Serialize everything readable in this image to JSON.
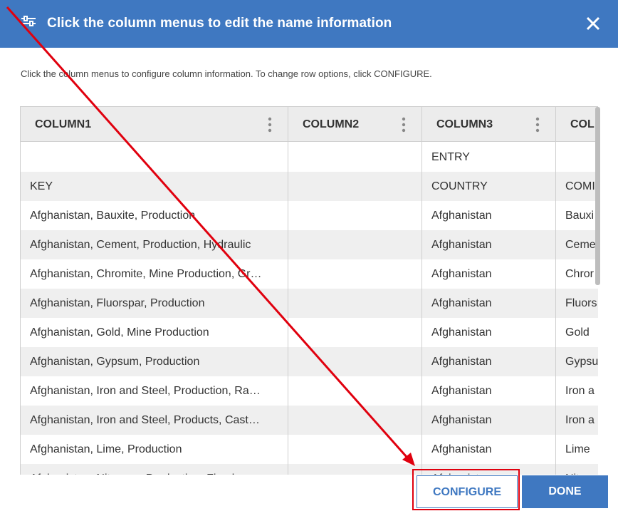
{
  "dialog": {
    "title": "Click the column menus to edit the name information",
    "instructions": "Click the column menus to configure column information. To change row options, click CONFIGURE."
  },
  "columns": [
    {
      "label": "COLUMN1"
    },
    {
      "label": "COLUMN2"
    },
    {
      "label": "COLUMN3"
    },
    {
      "label": "COL"
    }
  ],
  "rows": [
    {
      "c1": "",
      "c3": "ENTRY",
      "c4": ""
    },
    {
      "c1": "KEY",
      "c3": "COUNTRY",
      "c4": "COMI"
    },
    {
      "c1": "Afghanistan, Bauxite, Production",
      "c3": "Afghanistan",
      "c4": "Bauxi"
    },
    {
      "c1": "Afghanistan, Cement, Production, Hydraulic",
      "c3": "Afghanistan",
      "c4": "Ceme"
    },
    {
      "c1": "Afghanistan, Chromite, Mine Production, Gr…",
      "c3": "Afghanistan",
      "c4": "Chror"
    },
    {
      "c1": "Afghanistan, Fluorspar, Production",
      "c3": "Afghanistan",
      "c4": "Fluors"
    },
    {
      "c1": "Afghanistan, Gold, Mine Production",
      "c3": "Afghanistan",
      "c4": "Gold"
    },
    {
      "c1": "Afghanistan, Gypsum, Production",
      "c3": "Afghanistan",
      "c4": "Gypsu"
    },
    {
      "c1": "Afghanistan, Iron and Steel, Production, Ra…",
      "c3": "Afghanistan",
      "c4": "Iron a"
    },
    {
      "c1": "Afghanistan, Iron and Steel, Products, Cast…",
      "c3": "Afghanistan",
      "c4": "Iron a"
    },
    {
      "c1": "Afghanistan, Lime, Production",
      "c3": "Afghanistan",
      "c4": "Lime"
    },
    {
      "c1": "Afghanistan, Nitrogen, Production, Fixed…",
      "c3": "Afghanistan",
      "c4": "Nitro"
    }
  ],
  "buttons": {
    "configure": "CONFIGURE",
    "done": "DONE"
  },
  "icons": {
    "header": "sliders-icon",
    "close": "close-icon",
    "column_menu": "vertical-ellipsis-icon"
  },
  "colors": {
    "accent": "#3f78c1",
    "annotation": "#e0000e"
  }
}
